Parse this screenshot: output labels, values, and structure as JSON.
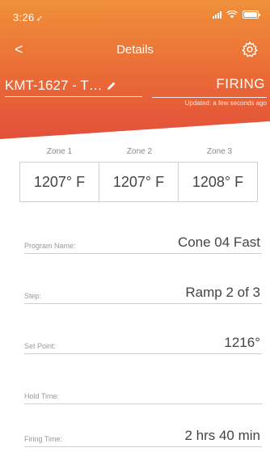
{
  "status_bar": {
    "time": "3:26",
    "location_glyph": "➶"
  },
  "nav": {
    "back": "<",
    "title": "Details",
    "settings_icon": "gear-icon"
  },
  "kiln": {
    "name": "KMT-1627 - T…",
    "status": "FIRING",
    "updated": "Updated: a few seconds ago"
  },
  "zones": [
    {
      "label": "Zone 1",
      "temp": "1207° F"
    },
    {
      "label": "Zone 2",
      "temp": "1207° F"
    },
    {
      "label": "Zone 3",
      "temp": "1208° F"
    }
  ],
  "fields": {
    "program_name": {
      "label": "Program Name:",
      "value": "Cone 04 Fast"
    },
    "step": {
      "label": "Step:",
      "value": "Ramp 2 of 3"
    },
    "set_point": {
      "label": "Set Point:",
      "value": "1216°"
    },
    "hold_time": {
      "label": "Hold Time:",
      "value": ""
    },
    "firing_time": {
      "label": "Firing Time:",
      "value": "2 hrs 40 min"
    }
  },
  "colors": {
    "header_top": "#f0903a",
    "header_bottom": "#e2503a"
  }
}
